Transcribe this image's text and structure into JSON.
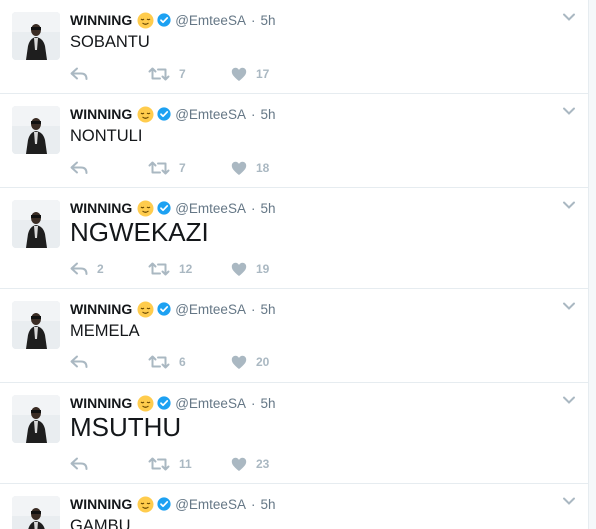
{
  "user": {
    "display_name": "WINNING",
    "handle": "@EmteeSA",
    "separator": "·",
    "emoji_icon": "relieved-face-emoji",
    "verified_icon": "verified-badge",
    "colors": {
      "verified": "#1da1f2",
      "emoji": "#ffcc4d",
      "action_gray": "#aab8c2",
      "meta_gray": "#657786",
      "text": "#14171a"
    }
  },
  "tweets": [
    {
      "time": "5h",
      "text": "SOBANTU",
      "replies": "",
      "retweets": "7",
      "likes": "17"
    },
    {
      "time": "5h",
      "text": "NONTULI",
      "replies": "",
      "retweets": "7",
      "likes": "18"
    },
    {
      "time": "5h",
      "text": "NGWEKAZI",
      "replies": "2",
      "retweets": "12",
      "likes": "19"
    },
    {
      "time": "5h",
      "text": "MEMELA",
      "replies": "",
      "retweets": "6",
      "likes": "20"
    },
    {
      "time": "5h",
      "text": "MSUTHU",
      "replies": "",
      "retweets": "11",
      "likes": "23"
    },
    {
      "time": "5h",
      "text": "GAMBU",
      "replies": "",
      "retweets": "",
      "likes": ""
    }
  ]
}
